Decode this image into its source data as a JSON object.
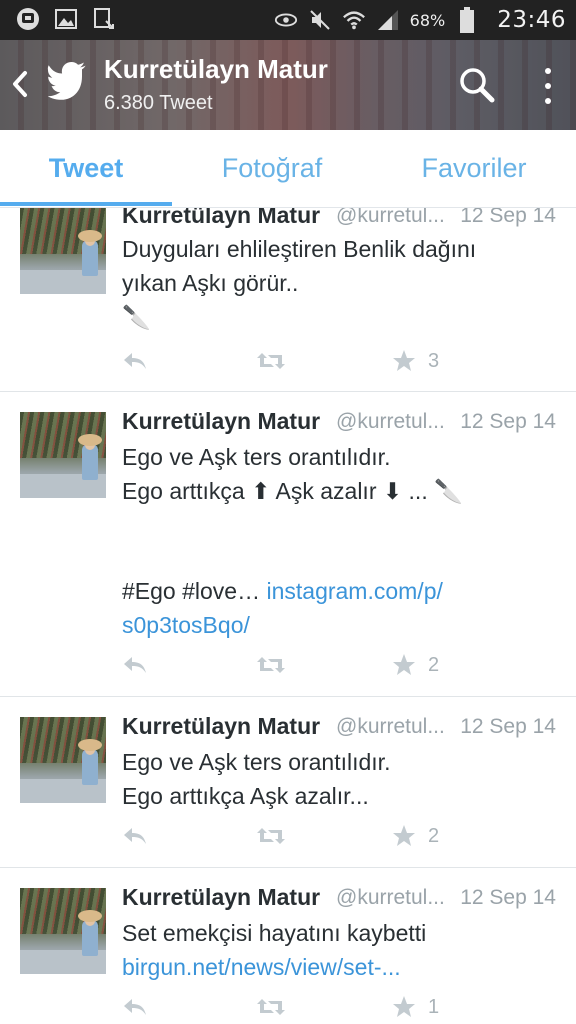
{
  "status_bar": {
    "battery_percent": "68%",
    "time": "23:46",
    "icons": [
      "app-badge-icon",
      "image-icon",
      "download-icon",
      "eye-icon",
      "mute-icon",
      "wifi-icon",
      "signal-icon",
      "battery-icon"
    ]
  },
  "header": {
    "title": "Kurretülayn Matur",
    "subtitle": "6.380 Tweet",
    "icons": [
      "back-icon",
      "twitter-bird-icon",
      "search-icon",
      "overflow-menu-icon"
    ]
  },
  "tabs": [
    {
      "label": "Tweet",
      "active": true
    },
    {
      "label": "Fotoğraf",
      "active": false
    },
    {
      "label": "Favoriler",
      "active": false
    }
  ],
  "colors": {
    "accent": "#55acee",
    "link": "#3b94d9",
    "text": "#292f33",
    "muted": "#9aa3a9"
  },
  "tweets": [
    {
      "name": "Kurretülayn Matur",
      "handle": "@kurretul...",
      "date": "12 Sep 14",
      "lines": [
        "Duyguları ehlileştiren Benlik dağını",
        "yıkan Aşkı görür..",
        "🔪"
      ],
      "favorites": "3"
    },
    {
      "name": "Kurretülayn Matur",
      "handle": "@kurretul...",
      "date": "12 Sep 14",
      "lines": [
        "Ego ve Aşk ters orantılıdır.",
        "Ego arttıkça ⬆ Aşk azalır ⬇ ... 🔪",
        "",
        "#Ego #love… "
      ],
      "link_part1": "instagram.com/p/",
      "link_part2": "s0p3tosBqo/",
      "favorites": "2"
    },
    {
      "name": "Kurretülayn Matur",
      "handle": "@kurretul...",
      "date": "12 Sep 14",
      "lines": [
        "Ego ve Aşk ters orantılıdır.",
        "Ego arttıkça Aşk azalır..."
      ],
      "favorites": "2"
    },
    {
      "name": "Kurretülayn Matur",
      "handle": "@kurretul...",
      "date": "12 Sep 14",
      "lines": [
        "Set emekçisi hayatını kaybetti"
      ],
      "link_part1": "birgun.net/news/view/set-...",
      "favorites": "1"
    }
  ]
}
